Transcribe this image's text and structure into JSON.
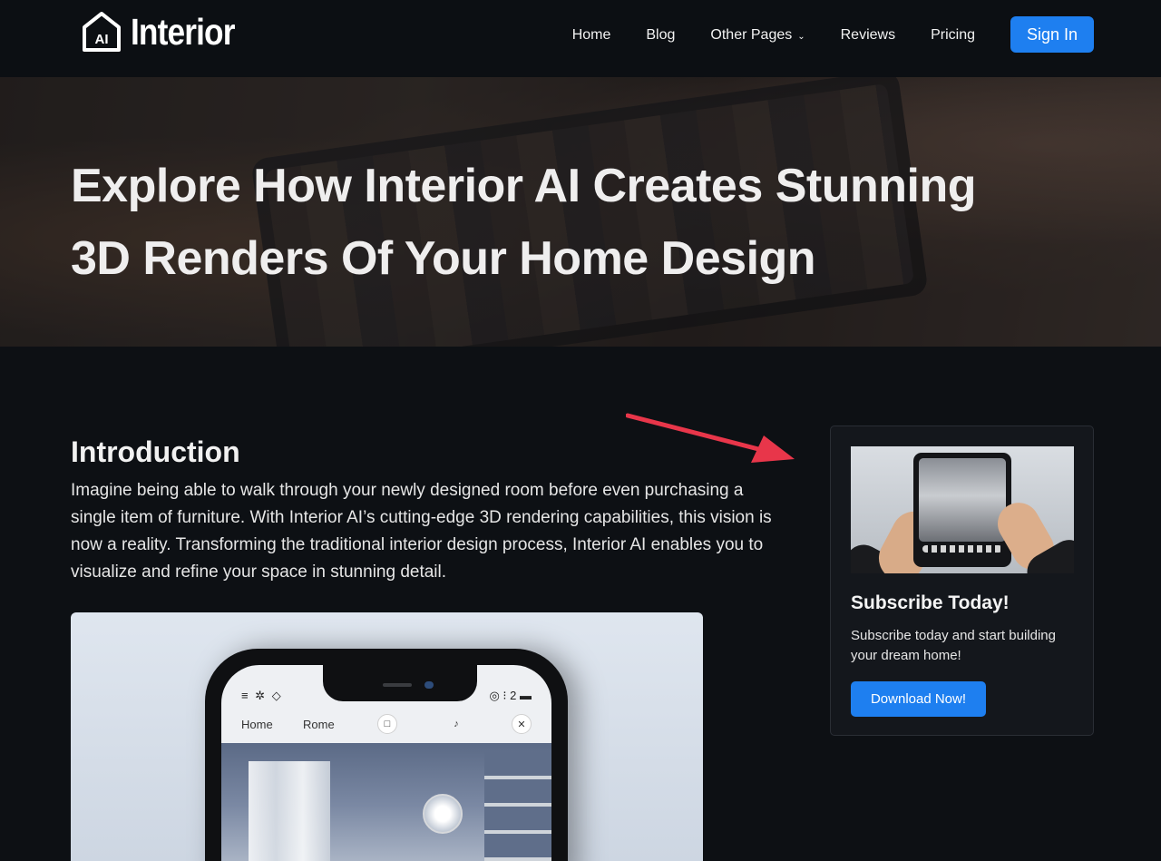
{
  "header": {
    "logo_badge": "AI",
    "logo_text": "Interior",
    "nav": [
      {
        "label": "Home"
      },
      {
        "label": "Blog"
      },
      {
        "label": "Other Pages"
      },
      {
        "label": "Reviews"
      },
      {
        "label": "Pricing"
      }
    ],
    "signin_label": "Sign In"
  },
  "hero": {
    "title_line1": "Explore How Interior AI Creates Stunning",
    "title_line2": "3D Renders Of Your Home Design"
  },
  "intro": {
    "heading": "Introduction",
    "text": "Imagine being able to walk through your newly designed room before even purchasing a single item of furniture. With Interior AI’s cutting-edge 3D rendering capabilities, this vision is now a reality. Transforming the traditional interior design process, Interior AI enables you to visualize and refine your space in stunning detail."
  },
  "sidebar_card": {
    "title": "Subscribe Today!",
    "text": "Subscribe today and start building your dream home!",
    "button_label": "Download Now!"
  },
  "article_image": {
    "tab_home": "Home",
    "tab_rome": "Rome",
    "status_right": "◎ ⁝ 2 ▬"
  },
  "colors": {
    "accent": "#1e7ff0",
    "background": "#0d1014",
    "arrow": "#e8364a"
  },
  "icons": {
    "nav_dropdown": "chevron-down-icon",
    "logo": "house-icon"
  }
}
